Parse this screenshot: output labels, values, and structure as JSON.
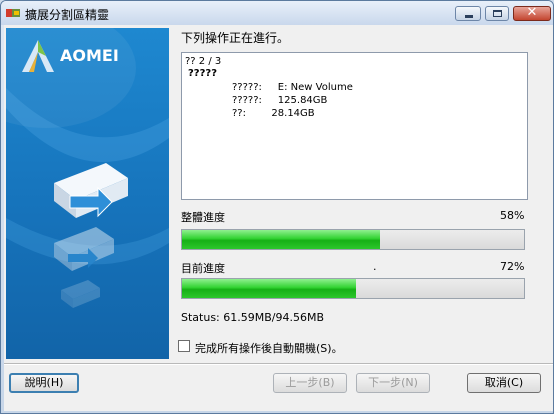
{
  "window": {
    "title": "擴展分割區精靈"
  },
  "banner": {
    "brand": "AOMEI"
  },
  "main": {
    "status_label": "下列操作正在進行。",
    "log": [
      "?? 2 / 3",
      "?????",
      "?????:     E: New Volume",
      "?????:     125.84GB",
      "??:        28.14GB"
    ],
    "overall": {
      "label": "整體進度",
      "percent_text": "58%",
      "progress": 0.58
    },
    "current": {
      "label": "目前進度",
      "dot": ".",
      "percent_text": "72%",
      "progress": 0.51
    },
    "status_text": "Status: 61.59MB/94.56MB",
    "shutdown_checkbox": {
      "label": "完成所有操作後自動關機(S)。",
      "checked": false
    }
  },
  "buttons": {
    "help": "說明(H)",
    "back": "上一步(B)",
    "next": "下一步(N)",
    "cancel": "取消(C)"
  },
  "colors": {
    "banner": "#1673bb",
    "progress": "#22c022",
    "title_bar": "#c9d8ec"
  }
}
